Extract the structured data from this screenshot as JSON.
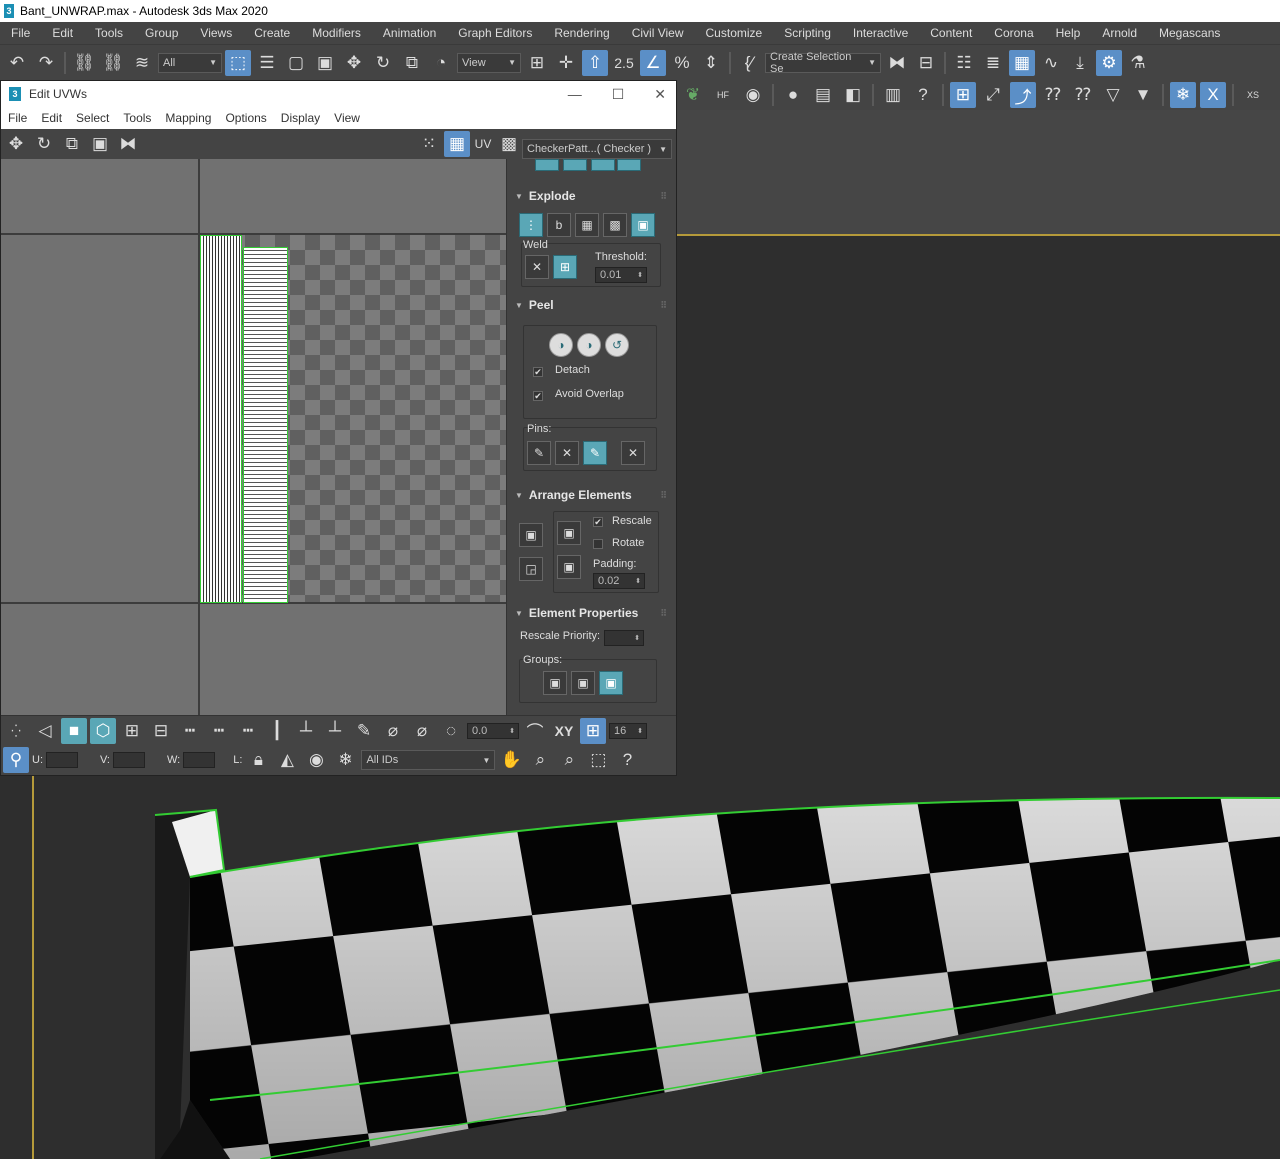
{
  "app": {
    "title": "Bant_UNWRAP.max - Autodesk 3ds Max 2020",
    "logo": "3"
  },
  "menubar": [
    "File",
    "Edit",
    "Tools",
    "Group",
    "Views",
    "Create",
    "Modifiers",
    "Animation",
    "Graph Editors",
    "Rendering",
    "Civil View",
    "Customize",
    "Scripting",
    "Interactive",
    "Content",
    "Corona",
    "Help",
    "Arnold",
    "Megascans"
  ],
  "main_toolbar": {
    "selection_filter": "All",
    "ref_coord": "View",
    "snap_label": "2.5",
    "selection_set": "Create Selection Se"
  },
  "second_toolbar": {
    "hf_label": "HF",
    "xs_label": "XS"
  },
  "uvw": {
    "title": "Edit UVWs",
    "logo": "3",
    "menu": [
      "File",
      "Edit",
      "Select",
      "Tools",
      "Mapping",
      "Options",
      "Display",
      "View"
    ],
    "uv_label": "UV",
    "checker_map": "CheckerPatt...( Checker )",
    "explode": {
      "title": "Explode",
      "weld_label": "Weld",
      "threshold_label": "Threshold:",
      "threshold_value": "0.01"
    },
    "peel": {
      "title": "Peel",
      "detach_label": "Detach",
      "detach_checked": true,
      "avoid_overlap_label": "Avoid Overlap",
      "avoid_overlap_checked": true,
      "pins_label": "Pins:"
    },
    "arrange": {
      "title": "Arrange Elements",
      "rescale_label": "Rescale",
      "rescale_checked": true,
      "rotate_label": "Rotate",
      "rotate_checked": false,
      "padding_label": "Padding:",
      "padding_value": "0.02"
    },
    "element_props": {
      "title": "Element Properties",
      "rescale_priority_label": "Rescale Priority:",
      "rescale_priority_value": "",
      "groups_label": "Groups:"
    },
    "bottom1": {
      "angle_value": "0.0",
      "xy_label": "XY",
      "grid_value": "16"
    },
    "bottom2": {
      "u_label": "U:",
      "v_label": "V:",
      "w_label": "W:",
      "l_label": "L:",
      "id_filter": "All IDs"
    }
  },
  "colors": {
    "accent": "#5b8fc7",
    "teal_icon": "#5aa7b6",
    "selection_edge": "#33cc33",
    "viewport_border": "#b59a3a"
  }
}
